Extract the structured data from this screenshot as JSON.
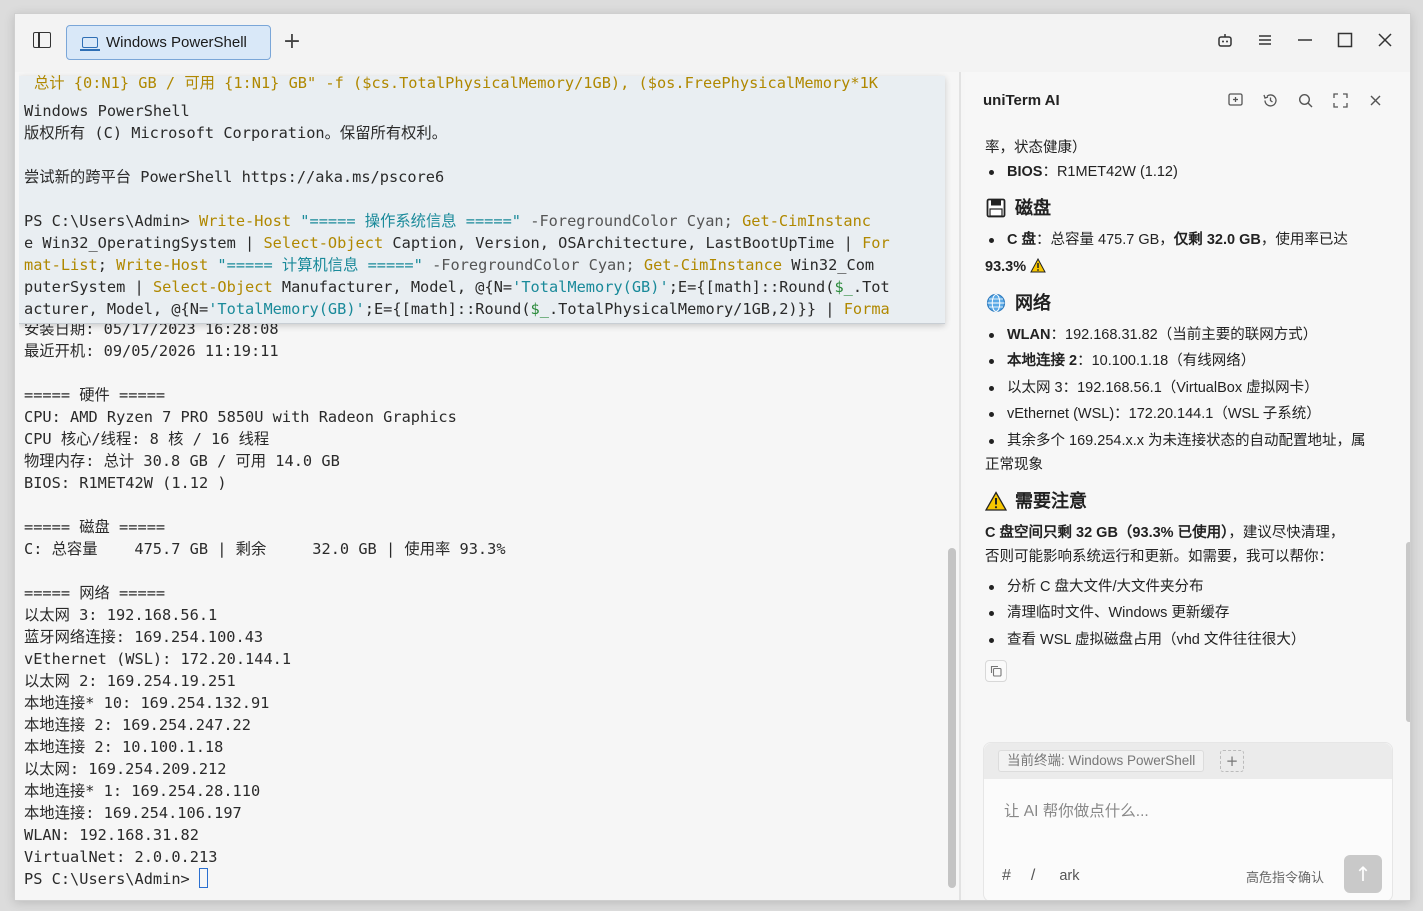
{
  "tab": {
    "label": "Windows PowerShell",
    "add": "+"
  },
  "terminal": {
    "cut_line": "总计 {0:N1} GB / 可用 {1:N1} GB\" -f ($cs.TotalPhysicalMemory/1GB), ($os.FreePhysicalMemory*1K",
    "overlay": {
      "l1": "Windows PowerShell",
      "l2": "版权所有 (C) Microsoft Corporation。保留所有权利。",
      "l3": "",
      "l4": "尝试新的跨平台 PowerShell https://aka.ms/pscore6",
      "l5": "",
      "c1_prompt": "PS C:\\Users\\Admin> ",
      "c1_a": "Write-Host",
      "c1_b": " \"===== 操作系统信息 =====\"",
      "c1_c": " -ForegroundColor Cyan; ",
      "c1_d": "Get-CimInstanc",
      "c2_a": "e Win32_OperatingSystem | ",
      "c2_b": "Select-Object",
      "c2_c": " Caption, Version, OSArchitecture, LastBootUpTime | ",
      "c2_d": "For",
      "c3_a": "mat-List",
      "c3_b": "; ",
      "c3_c": "Write-Host",
      "c3_d": " \"===== 计算机信息 =====\"",
      "c3_e": " -ForegroundColor Cyan; ",
      "c3_f": "Get-CimInstance",
      "c3_g": " Win32_Com",
      "c4_a": "puterSystem | ",
      "c4_b": "Select-Object",
      "c4_c": " Manufacturer, Model, @{N=",
      "c4_d": "'TotalMemory(GB)'",
      "c4_e": ";E={[math]::Round(",
      "c4_f": "$_",
      "c4_g": ".Tot",
      "c5_a": "acturer, Model, @{N=",
      "c5_b": "'TotalMemory(GB)'",
      "c5_c": ";E={[math]::Round(",
      "c5_d": "$_",
      "c5_e": ".TotalPhysicalMemory/1GB,2)}} | ",
      "c5_f": "Forma"
    },
    "lines": [
      "安装日期: 05/17/2023 16:28:08",
      "最近开机: 09/05/2026 11:19:11",
      "",
      "===== 硬件 =====",
      "CPU: AMD Ryzen 7 PRO 5850U with Radeon Graphics",
      "CPU 核心/线程: 8 核 / 16 线程",
      "物理内存: 总计 30.8 GB / 可用 14.0 GB",
      "BIOS: R1MET42W (1.12 )",
      "",
      "===== 磁盘 =====",
      "C: 总容量    475.7 GB | 剩余     32.0 GB | 使用率 93.3%",
      "",
      "===== 网络 =====",
      "以太网 3: 192.168.56.1",
      "蓝牙网络连接: 169.254.100.43",
      "vEthernet (WSL): 172.20.144.1",
      "以太网 2: 169.254.19.251",
      "本地连接* 10: 169.254.132.91",
      "本地连接 2: 169.254.247.22",
      "本地连接 2: 10.100.1.18",
      "以太网: 169.254.209.212",
      "本地连接* 1: 169.254.28.110",
      "本地连接: 169.254.106.197",
      "WLAN: 192.168.31.82",
      "VirtualNet: 2.0.0.213"
    ],
    "prompt": "PS C:\\Users\\Admin> "
  },
  "ai": {
    "title": "uniTerm AI",
    "top_text": "率，状态健康）",
    "bios_label": "BIOS",
    "bios_value": "：R1MET42W (1.12)",
    "disk_heading": "磁盘",
    "disk_label": "C 盘",
    "disk_text1": "：总容量 475.7 GB，",
    "disk_bold": "仅剩 32.0 GB",
    "disk_text2": "，使用率已达",
    "disk_text3": "93.3%",
    "net_heading": "网络",
    "net_items": [
      {
        "label": "WLAN",
        "text": "：192.168.31.82（当前主要的联网方式）"
      },
      {
        "label": "本地连接 2",
        "text": "：10.100.1.18（有线网络）"
      },
      {
        "label": "",
        "text": "以太网 3：192.168.56.1（VirtualBox 虚拟网卡）"
      },
      {
        "label": "",
        "text": "vEthernet (WSL)：172.20.144.1（WSL 子系统）"
      }
    ],
    "net_extra1": "其余多个 169.254.x.x 为未连接状态的自动配置地址，属",
    "net_extra2": "正常现象",
    "attention_heading": "需要注意",
    "attention_bold": "C 盘空间只剩 32 GB（93.3% 已使用）",
    "attention_text1": "，建议尽快清理，",
    "attention_text2": "否则可能影响系统运行和更新。如需要，我可以帮你：",
    "help_items": [
      "分析 C 盘大文件/大文件夹分布",
      "清理临时文件、Windows 更新缓存",
      "查看 WSL 虚拟磁盘占用（vhd 文件往往很大）"
    ]
  },
  "chat": {
    "terminal_chip": "当前终端: Windows PowerShell",
    "chip_add": "+",
    "placeholder": "让 AI 帮你做点什么...",
    "hash": "#",
    "slash": "/",
    "model": "ark",
    "risk_label": "高危指令确认",
    "send_glyph": "↑"
  }
}
